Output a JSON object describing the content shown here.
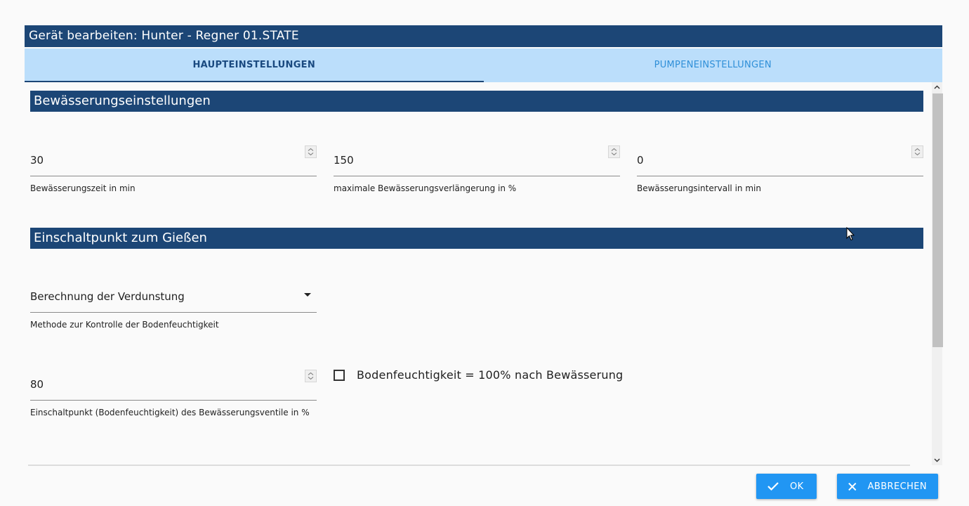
{
  "dialog": {
    "title": "Gerät bearbeiten: Hunter - Regner 01.STATE"
  },
  "tabs": [
    {
      "label": "HAUPTEINSTELLUNGEN",
      "active": true
    },
    {
      "label": "PUMPENEINSTELLUNGEN",
      "active": false
    }
  ],
  "sections": {
    "irrigation": {
      "title": "Bewässerungseinstellungen",
      "fields": [
        {
          "value": "30",
          "helper": "Bewässerungszeit in min"
        },
        {
          "value": "150",
          "helper": "maximale Bewässerungsverlängerung in %"
        },
        {
          "value": "0",
          "helper": "Bewässerungsintervall in min"
        }
      ]
    },
    "trigger": {
      "title": "Einschaltpunkt zum Gießen",
      "method_select": {
        "value": "Berechnung der Verdunstung",
        "helper": "Methode zur Kontrolle der Bodenfeuchtigkeit"
      },
      "threshold": {
        "value": "80",
        "helper": "Einschaltpunkt (Bodenfeuchtigkeit) des Bewässerungsventile in %"
      },
      "checkbox": {
        "label": "Bodenfeuchtigkeit = 100% nach Bewässerung",
        "checked": false
      }
    }
  },
  "footer": {
    "ok_label": "OK",
    "cancel_label": "ABBRECHEN"
  },
  "colors": {
    "header": "#1c4676",
    "tabs_bg": "#bbdefb",
    "button": "#2196f3"
  }
}
